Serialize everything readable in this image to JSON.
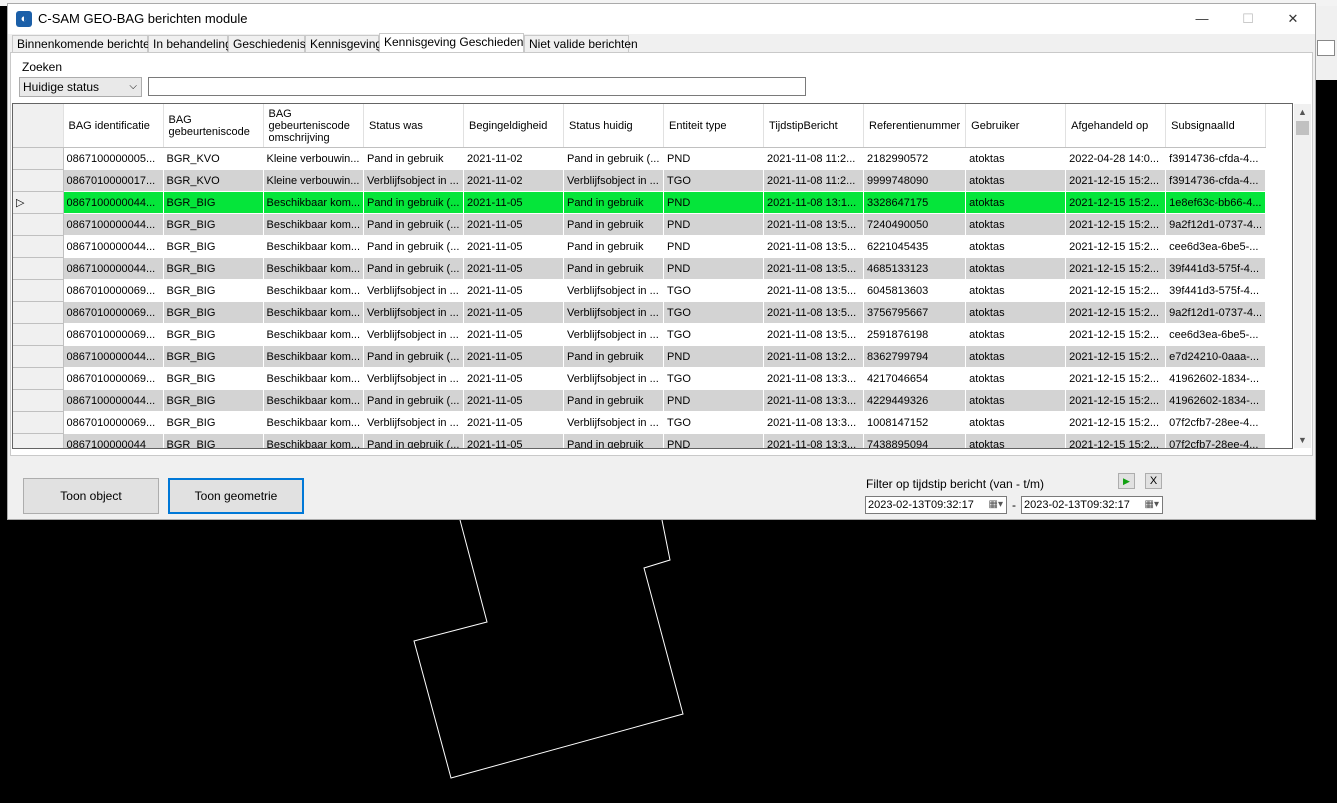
{
  "window": {
    "title": "C-SAM GEO-BAG berichten module",
    "minimize": "—",
    "maximize": "☐",
    "close": "✕"
  },
  "tabs": [
    "Binnenkomende berichten",
    "In behandeling",
    "Geschiedenis",
    "Kennisgeving",
    "Kennisgeving Geschiedenis",
    "Niet valide berichten"
  ],
  "active_tab": "Kennisgeving Geschiedenis",
  "search": {
    "label": "Zoeken",
    "status_select": "Huidige status",
    "query": ""
  },
  "grid": {
    "columns": [
      "BAG identificatie",
      "BAG gebeurteniscode",
      "BAG gebeurteniscode omschrijving",
      "Status was",
      "Begingeldigheid",
      "Status huidig",
      "Entiteit type",
      "TijdstipBericht",
      "Referentienummer",
      "Gebruiker",
      "Afgehandeld op",
      "SubsignaalId"
    ],
    "rows": [
      [
        "0867100000005...",
        "BGR_KVO",
        "Kleine verbouwin...",
        "Pand in gebruik",
        "2021-11-02",
        "Pand in gebruik (...",
        "PND",
        "2021-11-08 11:2...",
        "2182990572",
        "atoktas",
        "2022-04-28 14:0...",
        "f3914736-cfda-4..."
      ],
      [
        "0867010000017...",
        "BGR_KVO",
        "Kleine verbouwin...",
        "Verblijfsobject in ...",
        "2021-11-02",
        "Verblijfsobject in ...",
        "TGO",
        "2021-11-08 11:2...",
        "9999748090",
        "atoktas",
        "2021-12-15 15:2...",
        "f3914736-cfda-4..."
      ],
      [
        "0867100000044...",
        "BGR_BIG",
        "Beschikbaar kom...",
        "Pand in gebruik (...",
        "2021-11-05",
        "Pand in gebruik",
        "PND",
        "2021-11-08 13:1...",
        "3328647175",
        "atoktas",
        "2021-12-15 15:2...",
        "1e8ef63c-bb66-4..."
      ],
      [
        "0867100000044...",
        "BGR_BIG",
        "Beschikbaar kom...",
        "Pand in gebruik (...",
        "2021-11-05",
        "Pand in gebruik",
        "PND",
        "2021-11-08 13:5...",
        "7240490050",
        "atoktas",
        "2021-12-15 15:2...",
        "9a2f12d1-0737-4..."
      ],
      [
        "0867100000044...",
        "BGR_BIG",
        "Beschikbaar kom...",
        "Pand in gebruik (...",
        "2021-11-05",
        "Pand in gebruik",
        "PND",
        "2021-11-08 13:5...",
        "6221045435",
        "atoktas",
        "2021-12-15 15:2...",
        "cee6d3ea-6be5-..."
      ],
      [
        "0867100000044...",
        "BGR_BIG",
        "Beschikbaar kom...",
        "Pand in gebruik (...",
        "2021-11-05",
        "Pand in gebruik",
        "PND",
        "2021-11-08 13:5...",
        "4685133123",
        "atoktas",
        "2021-12-15 15:2...",
        "39f441d3-575f-4..."
      ],
      [
        "0867010000069...",
        "BGR_BIG",
        "Beschikbaar kom...",
        "Verblijfsobject in ...",
        "2021-11-05",
        "Verblijfsobject in ...",
        "TGO",
        "2021-11-08 13:5...",
        "6045813603",
        "atoktas",
        "2021-12-15 15:2...",
        "39f441d3-575f-4..."
      ],
      [
        "0867010000069...",
        "BGR_BIG",
        "Beschikbaar kom...",
        "Verblijfsobject in ...",
        "2021-11-05",
        "Verblijfsobject in ...",
        "TGO",
        "2021-11-08 13:5...",
        "3756795667",
        "atoktas",
        "2021-12-15 15:2...",
        "9a2f12d1-0737-4..."
      ],
      [
        "0867010000069...",
        "BGR_BIG",
        "Beschikbaar kom...",
        "Verblijfsobject in ...",
        "2021-11-05",
        "Verblijfsobject in ...",
        "TGO",
        "2021-11-08 13:5...",
        "2591876198",
        "atoktas",
        "2021-12-15 15:2...",
        "cee6d3ea-6be5-..."
      ],
      [
        "0867100000044...",
        "BGR_BIG",
        "Beschikbaar kom...",
        "Pand in gebruik (...",
        "2021-11-05",
        "Pand in gebruik",
        "PND",
        "2021-11-08 13:2...",
        "8362799794",
        "atoktas",
        "2021-12-15 15:2...",
        "e7d24210-0aaa-..."
      ],
      [
        "0867010000069...",
        "BGR_BIG",
        "Beschikbaar kom...",
        "Verblijfsobject in ...",
        "2021-11-05",
        "Verblijfsobject in ...",
        "TGO",
        "2021-11-08 13:3...",
        "4217046654",
        "atoktas",
        "2021-12-15 15:2...",
        "41962602-1834-..."
      ],
      [
        "0867100000044...",
        "BGR_BIG",
        "Beschikbaar kom...",
        "Pand in gebruik (...",
        "2021-11-05",
        "Pand in gebruik",
        "PND",
        "2021-11-08 13:3...",
        "4229449326",
        "atoktas",
        "2021-12-15 15:2...",
        "41962602-1834-..."
      ],
      [
        "0867010000069...",
        "BGR_BIG",
        "Beschikbaar kom...",
        "Verblijfsobject in ...",
        "2021-11-05",
        "Verblijfsobject in ...",
        "TGO",
        "2021-11-08 13:3...",
        "1008147152",
        "atoktas",
        "2021-12-15 15:2...",
        "07f2cfb7-28ee-4..."
      ],
      [
        "0867100000044",
        "BGR_BIG",
        "Beschikbaar kom...",
        "Pand in gebruik (...",
        "2021-11-05",
        "Pand in gebruik",
        "PND",
        "2021-11-08 13:3...",
        "7438895094",
        "atoktas",
        "2021-12-15 15:2...",
        "07f2cfb7-28ee-4..."
      ]
    ],
    "selected_row": 2,
    "selected_color": "#05e53a",
    "row_indicator": "▷"
  },
  "buttons": {
    "show_object": "Toon object",
    "show_geometry": "Toon geometrie"
  },
  "filter": {
    "label": "Filter op tijdstip bericht (van - t/m)",
    "from": "2023-02-13T09:32:17",
    "to": "2023-02-13T09:32:17",
    "separator": "-",
    "apply_icon": "play-icon",
    "apply_glyph": "▶",
    "clear_label": "X"
  },
  "icons": {
    "scroll_up": "▲",
    "scroll_down": "▼",
    "calendar": "▦▾",
    "select_arrow": "⌵"
  }
}
